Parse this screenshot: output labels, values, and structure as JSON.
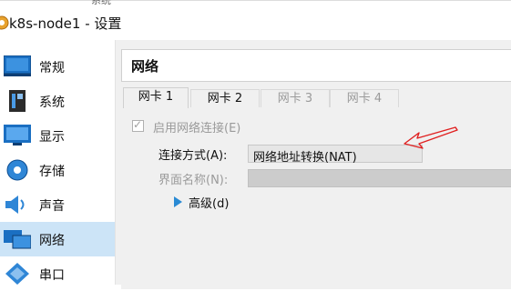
{
  "window": {
    "title": "k8s-node1 - 设置",
    "title_ghost": "系统"
  },
  "sidebar": {
    "items": [
      {
        "label": "常规",
        "icon": "monitor-icon"
      },
      {
        "label": "系统",
        "icon": "motherboard-icon"
      },
      {
        "label": "显示",
        "icon": "display-icon"
      },
      {
        "label": "存储",
        "icon": "disc-icon"
      },
      {
        "label": "声音",
        "icon": "speaker-icon"
      },
      {
        "label": "网络",
        "icon": "network-icon",
        "selected": true
      },
      {
        "label": "串口",
        "icon": "serial-port-icon"
      }
    ]
  },
  "main": {
    "heading": "网络",
    "tabs": [
      {
        "label": "网卡 1",
        "active": true
      },
      {
        "label": "网卡 2"
      },
      {
        "label": "网卡 3",
        "disabled": true
      },
      {
        "label": "网卡 4",
        "disabled": true
      }
    ],
    "enable_checkbox": {
      "label": "启用网络连接(E)",
      "checked": true
    },
    "attached_to": {
      "label": "连接方式(A):",
      "value": "网络地址转换(NAT)"
    },
    "name": {
      "label": "界面名称(N):",
      "value": ""
    },
    "advanced": {
      "label": "高级(d)"
    }
  },
  "colors": {
    "selected_item_bg": "#cce4f7",
    "annotation_arrow": "#e02020",
    "advanced_arrow": "#2a8ad4"
  }
}
